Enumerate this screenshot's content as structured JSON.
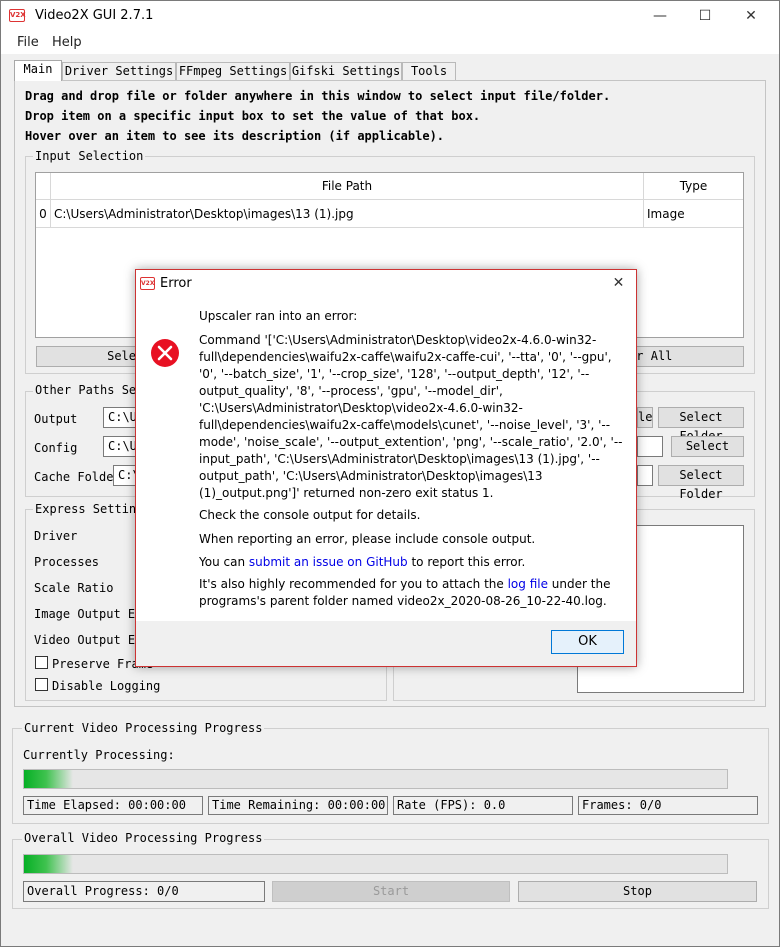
{
  "window": {
    "title": "Video2X GUI 2.7.1",
    "minimize": "—",
    "maximize": "☐",
    "close": "✕"
  },
  "menu": {
    "file": "File",
    "help": "Help"
  },
  "tabs": [
    {
      "label": "Main"
    },
    {
      "label": "Driver Settings"
    },
    {
      "label": "FFmpeg Settings"
    },
    {
      "label": "Gifski Settings"
    },
    {
      "label": "Tools"
    }
  ],
  "help_lines": [
    "Drag and drop file or folder anywhere in this window to select input file/folder.",
    "Drop item on a specific input box to set the value of that box.",
    "Hover over an item to see its description (if applicable)."
  ],
  "input_selection": {
    "title": "Input Selection",
    "columns": {
      "path": "File Path",
      "type": "Type"
    },
    "rows": [
      {
        "index": "0",
        "path": "C:\\Users\\Administrator\\Desktop\\images\\13 (1).jpg",
        "type": "Image"
      }
    ],
    "select_button": "Select F",
    "clear_button": "lear All"
  },
  "other_paths": {
    "title": "Other Paths Selec",
    "output_label": "Output",
    "output_value": "C:\\Us",
    "config_label": "Config",
    "config_value": "C:\\Us",
    "cache_label": "Cache Folder",
    "cache_value": "C:\\",
    "output_btn_partial": "le",
    "output_select": "Select Folder",
    "config_select": "Select",
    "cache_select": "Select Folder"
  },
  "express": {
    "title": "Express Settings",
    "driver": "Driver",
    "processes": "Processes",
    "scale_ratio": "Scale Ratio",
    "image_output": "Image Output Exte",
    "video_output": "Video Output Exte",
    "preserve_frames": "Preserve Frame",
    "disable_logging": "Disable Logging"
  },
  "current_progress": {
    "title": "Current Video Processing Progress",
    "currently_processing": "Currently Processing:",
    "progress": 0.07,
    "time_elapsed": "Time Elapsed: 00:00:00",
    "time_remaining": "Time Remaining: 00:00:00",
    "rate": "Rate (FPS): 0.0",
    "frames": "Frames: 0/0"
  },
  "overall_progress": {
    "title": "Overall Video Processing Progress",
    "progress": 0.07,
    "overall_label": "Overall Progress: 0/0",
    "start": "Start",
    "stop": "Stop"
  },
  "dialog": {
    "title": "Error",
    "close": "✕",
    "heading": "Upscaler ran into an error:",
    "command": "Command '['C:\\Users\\Administrator\\Desktop\\video2x-4.6.0-win32-full\\dependencies\\waifu2x-caffe\\waifu2x-caffe-cui', '--tta', '0', '--gpu', '0', '--batch_size', '1', '--crop_size', '128', '--output_depth', '12', '--output_quality', '8', '--process', 'gpu', '--model_dir', 'C:\\Users\\Administrator\\Desktop\\video2x-4.6.0-win32-full\\dependencies\\waifu2x-caffe\\models\\cunet', '--noise_level', '3', '--mode', 'noise_scale', '--output_extention', 'png', '--scale_ratio', '2.0', '--input_path', 'C:\\Users\\Administrator\\Desktop\\images\\13 (1).jpg', '--output_path', 'C:\\Users\\Administrator\\Desktop\\images\\13 (1)_output.png']' returned non-zero exit status 1.",
    "check_console": "Check the console output for details.",
    "report": "When reporting an error, please include console output.",
    "issue_prefix": "You can ",
    "issue_link": "submit an issue on GitHub",
    "issue_suffix": " to report this error.",
    "log_prefix": "It's also highly recommended for you to attach the ",
    "log_link": "log file",
    "log_suffix": " under the programs's parent folder named video2x_2020-08-26_10-22-40.log.",
    "ok": "OK"
  },
  "colors": {
    "error_red": "#e81123",
    "link_blue": "#0000e6",
    "progress_green": "#06b025",
    "accent": "#0078d7"
  }
}
